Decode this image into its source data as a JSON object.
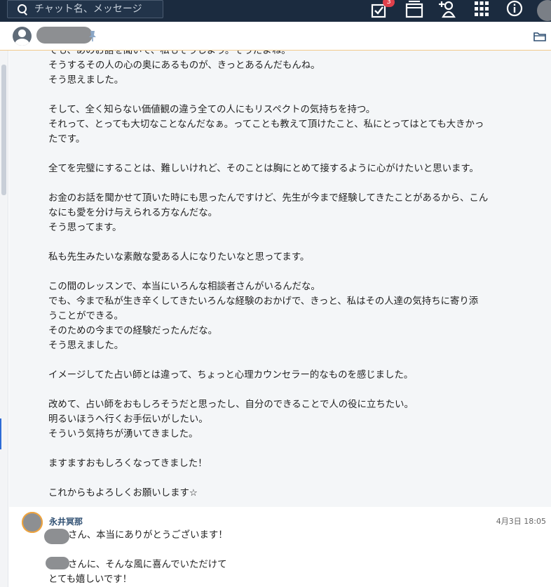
{
  "topbar": {
    "search_placeholder": "チャット名、メッセージ",
    "task_badge": "3",
    "icons": [
      "search-icon",
      "tasks-icon",
      "files-icon",
      "add-contact-icon",
      "apps-grid-icon",
      "info-icon",
      "user-avatar"
    ]
  },
  "chat_header": {
    "icons": [
      "contact-avatar",
      "pin-icon",
      "folder-icon"
    ]
  },
  "message1": {
    "lines": [
      "でも、あのお話を聞いて、私もそうしよう。そうだよね。",
      "そうするその人の心の奥にあるものが、きっとあるんだもんね。",
      "そう思えました。",
      "",
      "そして、全く知らない価値観の違う全ての人にもリスペクトの気持ちを持つ。",
      "それって、とっても大切なことなんだなぁ。ってことも教えて頂けたこと、私にとってはとても大きかっ",
      "たです。",
      "",
      "全てを完璧にすることは、難しいけれど、そのことは胸にとめて接するように心がけたいと思います。",
      "",
      "お金のお話を聞かせて頂いた時にも思ったんですけど、先生が今まで経験してきたことがあるから、こん",
      "なにも愛を分け与えられる方なんだな。",
      "そう思ってます。",
      "",
      "私も先生みたいな素敵な愛ある人になりたいなと思ってます。",
      "",
      "この間のレッスンで、本当にいろんな相談者さんがいるんだな。",
      "でも、今まで私が生き辛くしてきたいろんな経験のおかげで、きっと、私はその人達の気持ちに寄り添",
      "うことができる。",
      "そのための今までの経験だったんだな。",
      "そう思えました。",
      "",
      "イメージしてた占い師とは違って、ちょっと心理カウンセラー的なものを感じました。",
      "",
      "改めて、占い師をおもしろそうだと思ったし、自分のできることで人の役に立ちたい。",
      "明るいほうへ行くお手伝いがしたい。",
      "そういう気持ちが湧いてきました。",
      "",
      "ますますおもしろくなってきました！",
      "",
      "これからもよろしくお願いします☆"
    ]
  },
  "message2": {
    "sender": "永井冥那",
    "time": "4月3日 18:05",
    "line1": "さん、本当にありがとうございます！",
    "line2": "さんに、そんな風に喜んでいただけて",
    "line3": "とても嬉しいです！"
  }
}
